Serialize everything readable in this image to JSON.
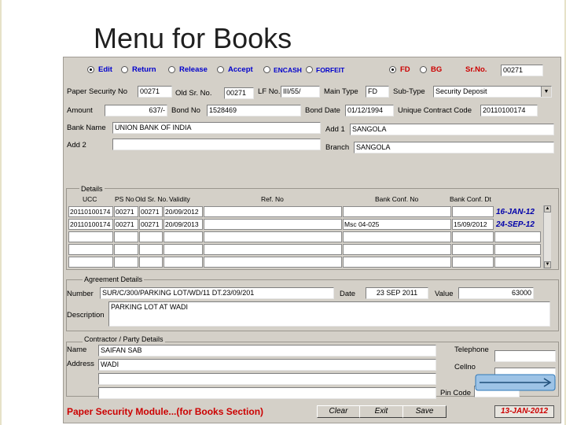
{
  "slide": {
    "title": "Menu for Books"
  },
  "mode": {
    "options": [
      {
        "label": "Edit",
        "selected": true
      },
      {
        "label": "Return",
        "selected": false
      },
      {
        "label": "Release",
        "selected": false
      },
      {
        "label": "Accept",
        "selected": false
      },
      {
        "label": "ENCASH",
        "selected": false
      },
      {
        "label": "FORFEIT",
        "selected": false
      }
    ],
    "type_options": [
      {
        "label": "FD",
        "selected": true
      },
      {
        "label": "BG",
        "selected": false
      }
    ],
    "sr_no_label": "Sr.No.",
    "sr_no_value": "00271"
  },
  "fields": {
    "paper_security_no": {
      "label": "Paper Security No",
      "value": "00271"
    },
    "old_sr_no": {
      "label": "Old Sr. No.",
      "value": "00271"
    },
    "lf_no": {
      "label": "LF No.",
      "value": "III/55/"
    },
    "main_type": {
      "label": "Main Type",
      "value": "FD"
    },
    "sub_type": {
      "label": "Sub-Type",
      "value": "Security Deposit"
    },
    "amount": {
      "label": "Amount",
      "value": "637/-"
    },
    "bond_no": {
      "label": "Bond No",
      "value": "1528469"
    },
    "bond_date": {
      "label": "Bond Date",
      "value": "01/12/1994"
    },
    "unique_contract_code": {
      "label": "Unique Contract Code",
      "value": "20110100174"
    },
    "bank_name": {
      "label": "Bank Name",
      "value": "UNION BANK OF INDIA"
    },
    "add1": {
      "label": "Add 1",
      "value": "SANGOLA"
    },
    "add2": {
      "label": "Add 2",
      "value": ""
    },
    "branch": {
      "label": "Branch",
      "value": "SANGOLA"
    }
  },
  "details": {
    "group_label": "Details",
    "columns": [
      "UCC",
      "PS No",
      "Old Sr. No.",
      "Validity",
      "Ref. No",
      "Bank Conf. No",
      "Bank Conf. Dt"
    ],
    "rows": [
      [
        "20110100174",
        "00271",
        "00271",
        "20/09/2012",
        "",
        "",
        "",
        "16-JAN-12"
      ],
      [
        "20110100174",
        "00271",
        "00271",
        "20/09/2013",
        "",
        "Msc 04-025",
        "15/09/2012",
        "24-SEP-12"
      ],
      [
        "",
        "",
        "",
        "",
        "",
        "",
        "",
        ""
      ],
      [
        "",
        "",
        "",
        "",
        "",
        "",
        "",
        ""
      ],
      [
        "",
        "",
        "",
        "",
        "",
        "",
        "",
        ""
      ]
    ]
  },
  "agreement": {
    "group_label": "Agreement Details",
    "number_label": "Number",
    "number_value": "SUR/C/300/PARKING LOT/WD/11 DT.23/09/201",
    "date_label": "Date",
    "date_value": "23 SEP 2011",
    "value_label": "Value",
    "value_value": "63000",
    "description_label": "Description",
    "description_value": "PARKING LOT AT WADI"
  },
  "contractor": {
    "group_label": "Contractor / Party Details",
    "name_label": "Name",
    "name_value": "SAIFAN SAB",
    "address_label": "Address",
    "address_line1": "WADI",
    "address_line2": "",
    "address_line3": "",
    "telephone_label": "Telephone",
    "telephone_value": "",
    "cellno_label": "Cellno",
    "cellno_value": "",
    "pincode_label": "Pin Code",
    "pincode_value": ""
  },
  "footer": {
    "module_title": "Paper Security Module...(for Books Section)",
    "clear_label": "Clear",
    "exit_label": "Exit",
    "save_label": "Save",
    "date": "13-JAN-2012"
  },
  "colors": {
    "form_bg": "#d4d0c8",
    "mode_label": "#0000cc",
    "accent_red": "#cc0000",
    "date_blue": "#0000aa",
    "arrow_blue": "#2e78b8"
  }
}
